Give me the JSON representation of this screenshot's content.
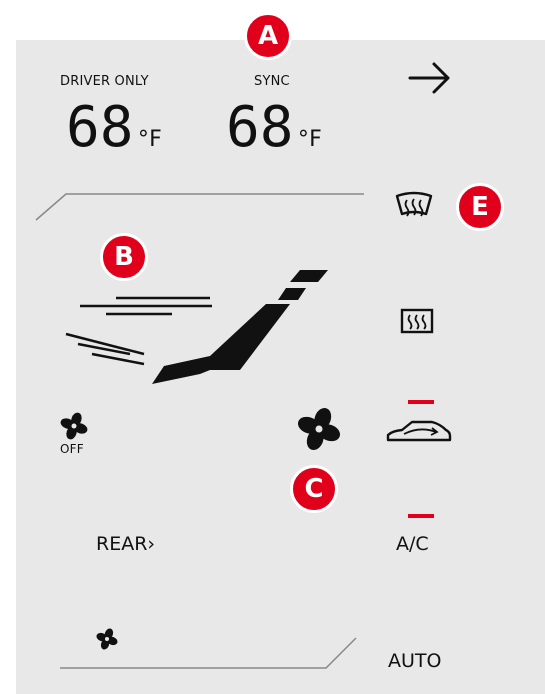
{
  "climate": {
    "driver_zone_label": "DRIVER ONLY",
    "sync_label": "SYNC",
    "driver_temp": "68",
    "sync_temp": "68",
    "temp_unit": "°F",
    "fan_off_label": "OFF",
    "rear_label": "REAR",
    "rear_arrow": "›",
    "ac_label": "A/C",
    "auto_label": "AUTO"
  },
  "callouts": {
    "a": "A",
    "b": "B",
    "c": "C",
    "e": "E"
  },
  "colors": {
    "panel": "#e8e8e8",
    "ink": "#111111",
    "indicator": "#e0001b",
    "callout": "#e0001b"
  },
  "icons": [
    "next-arrow-icon",
    "windshield-defrost-icon",
    "rear-defrost-icon",
    "fan-off-icon",
    "fan-speed-icon",
    "recirculation-icon",
    "fan-icon"
  ]
}
